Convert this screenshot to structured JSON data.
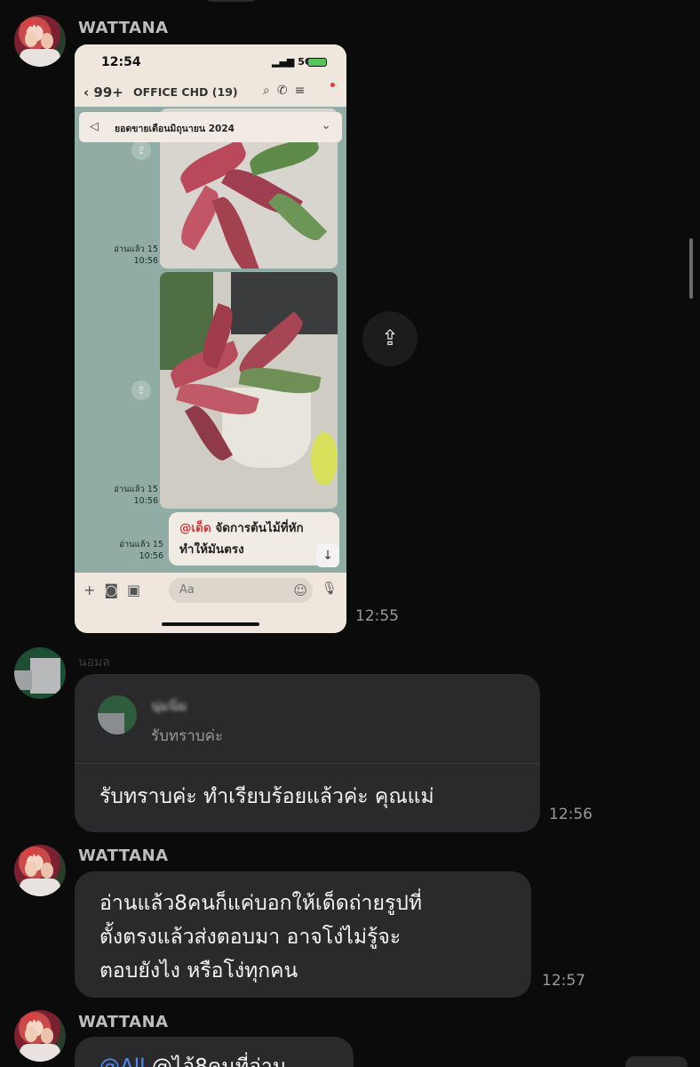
{
  "colors": {
    "background": "#0b0b0c",
    "bubble": "#2a2a2c",
    "mention": "#4f8df2"
  },
  "messages": {
    "m1": {
      "sender": "WATTANA",
      "time": "12:55",
      "screenshot": {
        "status_time": "12:54",
        "signal": "5G",
        "back_count": "99+",
        "chat_title": "OFFICE CHD (19)",
        "announcement": "ยอดขายเดือนมิถุนายน 2024",
        "read_label": "อ่านแล้ว 15",
        "read_time": "10:56",
        "msg_mention": "@เด็ด",
        "msg_text_1": " จัดการต้นไม้ที่หัก",
        "msg_text_2": "ทำให้มันตรง",
        "input_placeholder": "Aa"
      }
    },
    "m2": {
      "sender": "นอมล",
      "reply_name": "นุ่มนิ่ม",
      "reply_text": "รับทราบค่ะ",
      "text": "รับทราบค่ะ ทำเรียบร้อยแล้วค่ะ คุณแม่",
      "time": "12:56"
    },
    "m3": {
      "sender": "WATTANA",
      "lines": [
        "อ่านแล้ว8คนก็แค่บอกให้เด็ดถ่ายรูปที่",
        "ตั้งตรงแล้วส่งตอบมา อาจโง่ไม่รู้จะ",
        "ตอบยังไง หรือโง่ทุกคน"
      ],
      "time": "12:57"
    },
    "m4": {
      "sender": "WATTANA",
      "mention": "@All",
      "text_partial": " @ไอ้8คนที่อ่าน"
    }
  },
  "icons": [
    "share-icon",
    "back-chevron-icon",
    "search-icon",
    "phone-icon",
    "menu-icon",
    "megaphone-icon",
    "plus-icon",
    "camera-icon",
    "image-icon",
    "emoji-icon",
    "mic-icon",
    "arrow-down-icon"
  ]
}
